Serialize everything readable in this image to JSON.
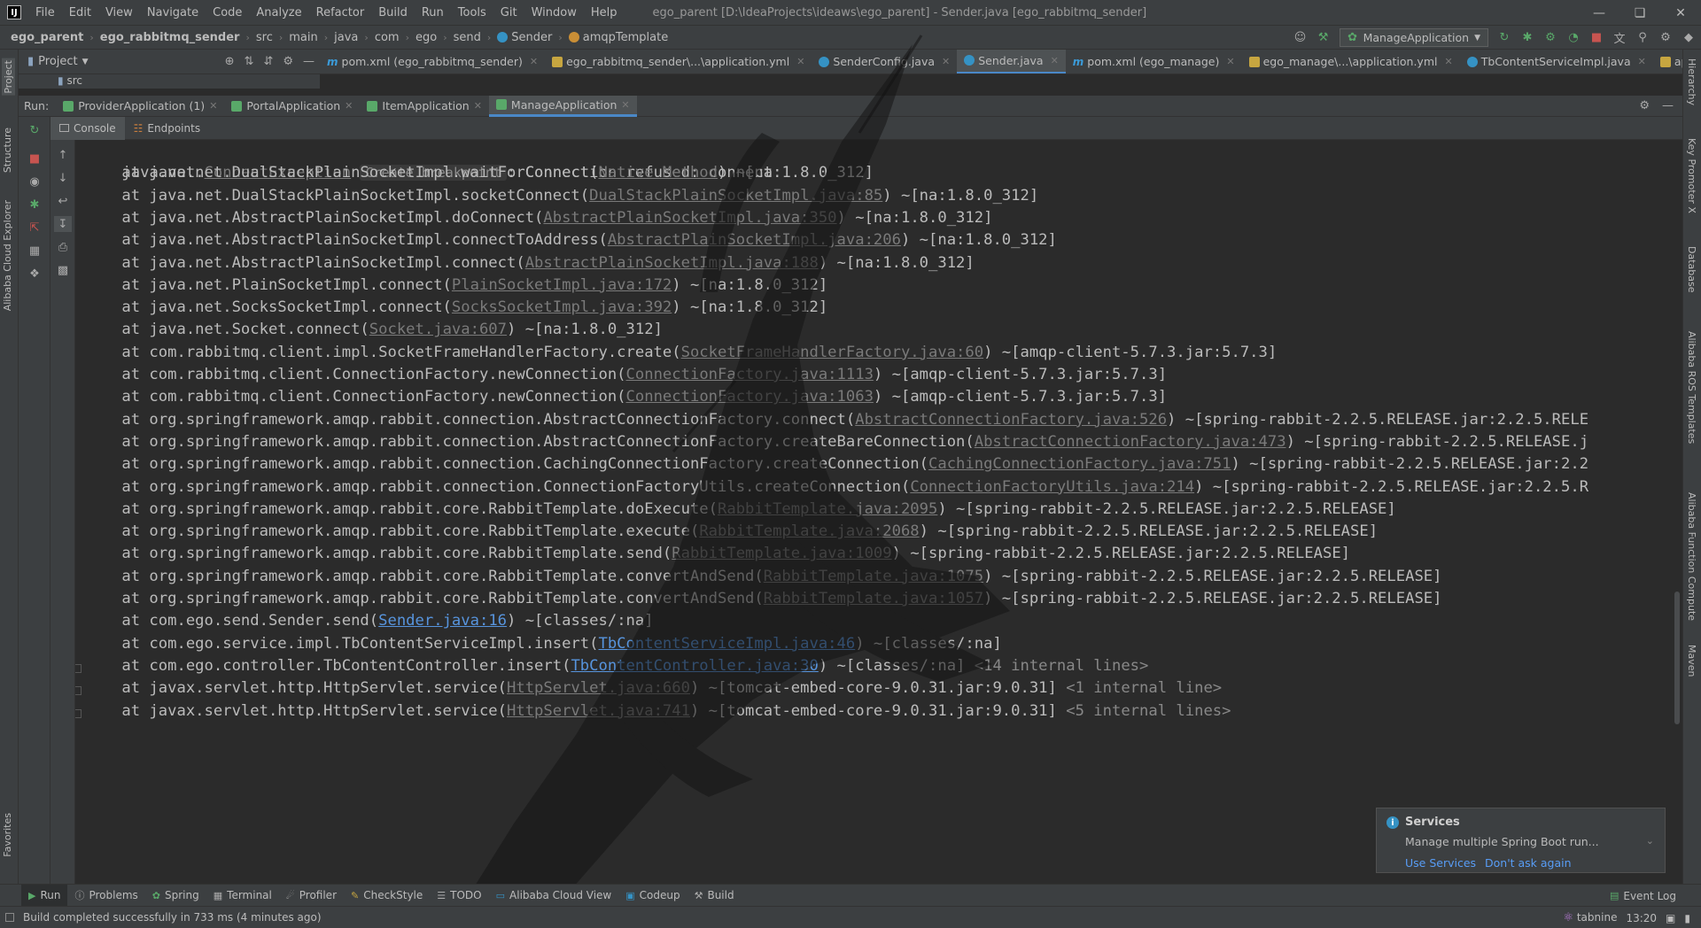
{
  "menubar": {
    "items": [
      "File",
      "Edit",
      "View",
      "Navigate",
      "Code",
      "Analyze",
      "Refactor",
      "Build",
      "Run",
      "Tools",
      "Git",
      "Window",
      "Help"
    ],
    "title": "ego_parent [D:\\IdeaProjects\\ideaws\\ego_parent] - Sender.java [ego_rabbitmq_sender]"
  },
  "breadcrumb": [
    "ego_parent",
    "ego_rabbitmq_sender",
    "src",
    "main",
    "java",
    "com",
    "ego",
    "send",
    "Sender",
    "amqpTemplate"
  ],
  "run_config": "ManageApplication",
  "project": {
    "title": "Project",
    "tree_item": "src"
  },
  "editor_tabs": [
    "pom.xml (ego_rabbitmq_sender)",
    "ego_rabbitmq_sender\\...\\application.yml",
    "SenderConfig.java",
    "Sender.java",
    "pom.xml (ego_manage)",
    "ego_manage\\...\\application.yml",
    "TbContentServiceImpl.java",
    "applicatio"
  ],
  "run": {
    "label": "Run:",
    "tabs": [
      "ProviderApplication (1)",
      "PortalApplication",
      "ItemApplication",
      "ManageApplication"
    ]
  },
  "console_tabs": [
    "Console",
    "Endpoints"
  ],
  "console": {
    "first": {
      "prefix": "java.net.",
      "link": "ConnectException",
      "hint": "Create breakpoint",
      "rest": ": Connection refused: connect"
    },
    "lines": [
      {
        "pre": "    at java.net.DualStackPlainSocketImpl.waitForConnect(",
        "link": "Native Method",
        "post": ") ~[na:1.8.0_312]",
        "fold": ""
      },
      {
        "pre": "    at java.net.DualStackPlainSocketImpl.socketConnect(",
        "link": "DualStackPlainSocketImpl.java:85",
        "post": ") ~[na:1.8.0_312]",
        "fold": ""
      },
      {
        "pre": "    at java.net.AbstractPlainSocketImpl.doConnect(",
        "link": "AbstractPlainSocketImpl.java:350",
        "post": ") ~[na:1.8.0_312]",
        "fold": ""
      },
      {
        "pre": "    at java.net.AbstractPlainSocketImpl.connectToAddress(",
        "link": "AbstractPlainSocketImpl.java:206",
        "post": ") ~[na:1.8.0_312]",
        "fold": ""
      },
      {
        "pre": "    at java.net.AbstractPlainSocketImpl.connect(",
        "link": "AbstractPlainSocketImpl.java:188",
        "post": ") ~[na:1.8.0_312]",
        "fold": ""
      },
      {
        "pre": "    at java.net.PlainSocketImpl.connect(",
        "link": "PlainSocketImpl.java:172",
        "post": ") ~[na:1.8.0_312]",
        "fold": ""
      },
      {
        "pre": "    at java.net.SocksSocketImpl.connect(",
        "link": "SocksSocketImpl.java:392",
        "post": ") ~[na:1.8.0_312]",
        "fold": ""
      },
      {
        "pre": "    at java.net.Socket.connect(",
        "link": "Socket.java:607",
        "post": ") ~[na:1.8.0_312]",
        "fold": ""
      },
      {
        "pre": "    at com.rabbitmq.client.impl.SocketFrameHandlerFactory.create(",
        "link": "SocketFrameHandlerFactory.java:60",
        "post": ") ~[amqp-client-5.7.3.jar:5.7.3]",
        "fold": ""
      },
      {
        "pre": "    at com.rabbitmq.client.ConnectionFactory.newConnection(",
        "link": "ConnectionFactory.java:1113",
        "post": ") ~[amqp-client-5.7.3.jar:5.7.3]",
        "fold": ""
      },
      {
        "pre": "    at com.rabbitmq.client.ConnectionFactory.newConnection(",
        "link": "ConnectionFactory.java:1063",
        "post": ") ~[amqp-client-5.7.3.jar:5.7.3]",
        "fold": ""
      },
      {
        "pre": "    at org.springframework.amqp.rabbit.connection.AbstractConnectionFactory.connect(",
        "link": "AbstractConnectionFactory.java:526",
        "post": ") ~[spring-rabbit-2.2.5.RELEASE.jar:2.2.5.RELE",
        "fold": ""
      },
      {
        "pre": "    at org.springframework.amqp.rabbit.connection.AbstractConnectionFactory.createBareConnection(",
        "link": "AbstractConnectionFactory.java:473",
        "post": ") ~[spring-rabbit-2.2.5.RELEASE.j",
        "fold": ""
      },
      {
        "pre": "    at org.springframework.amqp.rabbit.connection.CachingConnectionFactory.createConnection(",
        "link": "CachingConnectionFactory.java:751",
        "post": ") ~[spring-rabbit-2.2.5.RELEASE.jar:2.2",
        "fold": ""
      },
      {
        "pre": "    at org.springframework.amqp.rabbit.connection.ConnectionFactoryUtils.createConnection(",
        "link": "ConnectionFactoryUtils.java:214",
        "post": ") ~[spring-rabbit-2.2.5.RELEASE.jar:2.2.5.R",
        "fold": ""
      },
      {
        "pre": "    at org.springframework.amqp.rabbit.core.RabbitTemplate.doExecute(",
        "link": "RabbitTemplate.java:2095",
        "post": ") ~[spring-rabbit-2.2.5.RELEASE.jar:2.2.5.RELEASE]",
        "fold": ""
      },
      {
        "pre": "    at org.springframework.amqp.rabbit.core.RabbitTemplate.execute(",
        "link": "RabbitTemplate.java:2068",
        "post": ") ~[spring-rabbit-2.2.5.RELEASE.jar:2.2.5.RELEASE]",
        "fold": ""
      },
      {
        "pre": "    at org.springframework.amqp.rabbit.core.RabbitTemplate.send(",
        "link": "RabbitTemplate.java:1009",
        "post": ") ~[spring-rabbit-2.2.5.RELEASE.jar:2.2.5.RELEASE]",
        "fold": ""
      },
      {
        "pre": "    at org.springframework.amqp.rabbit.core.RabbitTemplate.convertAndSend(",
        "link": "RabbitTemplate.java:1075",
        "post": ") ~[spring-rabbit-2.2.5.RELEASE.jar:2.2.5.RELEASE]",
        "fold": ""
      },
      {
        "pre": "    at org.springframework.amqp.rabbit.core.RabbitTemplate.convertAndSend(",
        "link": "RabbitTemplate.java:1057",
        "post": ") ~[spring-rabbit-2.2.5.RELEASE.jar:2.2.5.RELEASE]",
        "fold": ""
      },
      {
        "pre": "    at com.ego.send.Sender.send(",
        "link": "Sender.java:16",
        "post": ") ~[classes/:na]",
        "fold": "",
        "blue": true
      },
      {
        "pre": "    at com.ego.service.impl.TbContentServiceImpl.insert(",
        "link": "TbContentServiceImpl.java:46",
        "post": ") ~[classes/:na]",
        "fold": "",
        "blue": true
      },
      {
        "pre": "    at com.ego.controller.TbContentController.insert(",
        "link": "TbContentController.java:30",
        "post": ") ~[classes/:na] ",
        "fold": "<14 internal lines>",
        "blue": true
      },
      {
        "pre": "    at javax.servlet.http.HttpServlet.service(",
        "link": "HttpServlet.java:660",
        "post": ") ~[tomcat-embed-core-9.0.31.jar:9.0.31] ",
        "fold": "<1 internal line>"
      },
      {
        "pre": "    at javax.servlet.http.HttpServlet.service(",
        "link": "HttpServlet.java:741",
        "post": ") ~[tomcat-embed-core-9.0.31.jar:9.0.31] ",
        "fold": "<5 internal lines>"
      }
    ]
  },
  "popup": {
    "title": "Services",
    "body": "Manage multiple Spring Boot run...",
    "link1": "Use Services",
    "link2": "Don't ask again"
  },
  "bottom_tabs": [
    "Run",
    "Problems",
    "Spring",
    "Terminal",
    "Profiler",
    "CheckStyle",
    "TODO",
    "Alibaba Cloud View",
    "Codeup",
    "Build"
  ],
  "event_log": "Event Log",
  "status": {
    "message": "Build completed successfully in 733 ms (4 minutes ago)",
    "plugin": "tabnine",
    "time": "13:20"
  },
  "left_strip_tabs": [
    "Project",
    "Structure",
    "Alibaba Cloud Explorer",
    "Favorites"
  ],
  "right_strip_tabs": [
    "Hierarchy",
    "Key Promoter X",
    "Database",
    "Alibaba ROS Templates",
    "Alibaba Function Compute",
    "Maven"
  ],
  "icons": {
    "app": "intellij-logo-icon",
    "class": "class-icon",
    "field": "field-icon",
    "info": "info-icon"
  },
  "colors": {
    "background": "#2b2b2b",
    "panel": "#3c3f41",
    "accent": "#4a88c7",
    "link": "#5794dd",
    "green": "#59a869",
    "red": "#c75450"
  }
}
